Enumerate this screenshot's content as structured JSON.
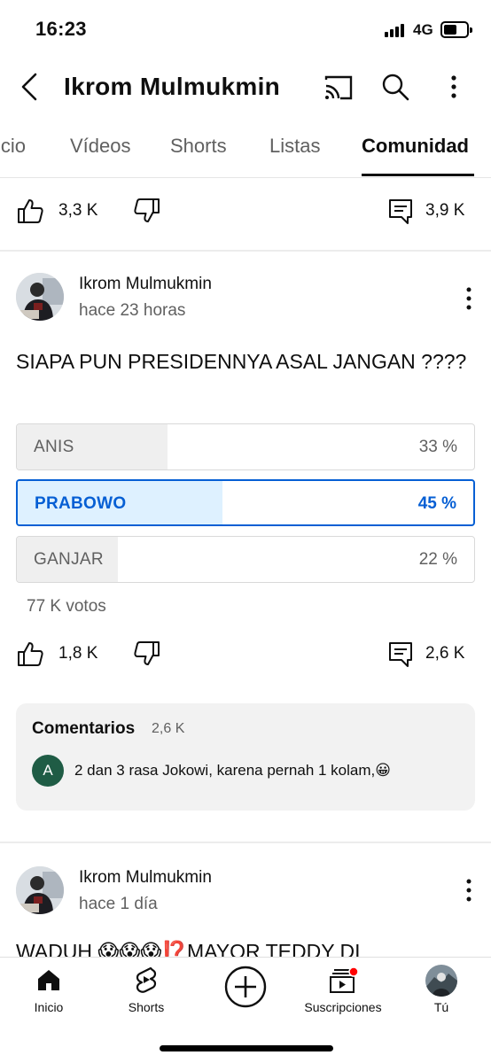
{
  "status_bar": {
    "time": "16:23",
    "network": "4G"
  },
  "header": {
    "channel_name": "Ikrom Mulmukmin"
  },
  "tabs": [
    {
      "label": "icio"
    },
    {
      "label": "Vídeos"
    },
    {
      "label": "Shorts"
    },
    {
      "label": "Listas"
    },
    {
      "label": "Comunidad",
      "active": true
    }
  ],
  "prev_post": {
    "likes": "3,3 K",
    "comments": "3,9 K"
  },
  "post1": {
    "author": "Ikrom Mulmukmin",
    "time": "hace 23 horas",
    "text": "SIAPA PUN PRESIDENNYA ASAL JANGAN ????",
    "poll": {
      "options": [
        {
          "label": "ANIS",
          "percent": "33 %",
          "share": 0.33,
          "selected": false
        },
        {
          "label": "PRABOWO",
          "percent": "45 %",
          "share": 0.45,
          "selected": true
        },
        {
          "label": "GANJAR",
          "percent": "22 %",
          "share": 0.22,
          "selected": false
        }
      ],
      "votes": "77 K votos"
    },
    "likes": "1,8 K",
    "comments": "2,6 K",
    "comments_card": {
      "title": "Comentarios",
      "count": "2,6 K",
      "top_comment_avatar_letter": "A",
      "top_comment_text": "2 dan 3 rasa Jokowi, karena pernah 1 kolam,😀"
    }
  },
  "post2": {
    "author": "Ikrom Mulmukmin",
    "time": "hace 1 día",
    "text": "WADUH 😱😱😱⁉️MAYOR TEDDY DI"
  },
  "bottom_nav": [
    {
      "label": "Inicio",
      "icon": "home-icon"
    },
    {
      "label": "Shorts",
      "icon": "shorts-icon"
    },
    {
      "label": "",
      "icon": "create-icon"
    },
    {
      "label": "Suscripciones",
      "icon": "subscriptions-icon"
    },
    {
      "label": "Tú",
      "icon": "profile-avatar"
    }
  ],
  "colors": {
    "accent": "#065fd4",
    "selected_fill": "#def1ff",
    "bar_fill": "#efefef",
    "notification": "#ff0000"
  }
}
